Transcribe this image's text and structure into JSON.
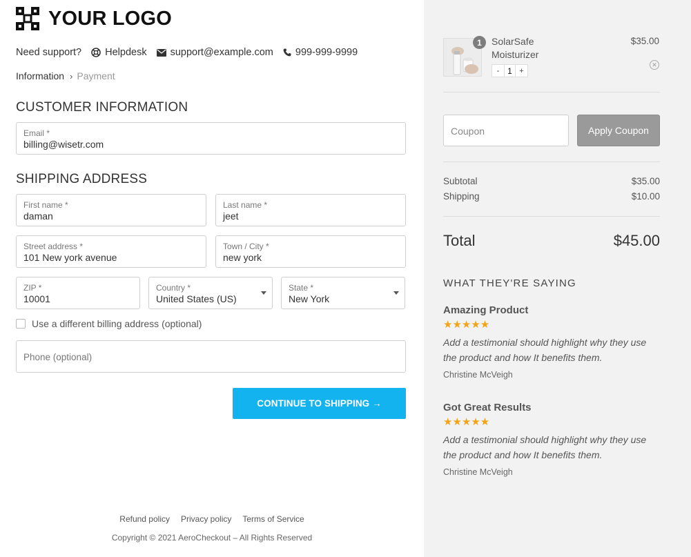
{
  "logo": {
    "text": "YOUR LOGO",
    "icon": "logo-mark-icon"
  },
  "support": {
    "label": "Need support?",
    "helpdesk": "Helpdesk",
    "email": "support@example.com",
    "phone": "999-999-9999"
  },
  "breadcrumb": {
    "step1": "Information",
    "step2": "Payment"
  },
  "customer_info": {
    "title": "CUSTOMER INFORMATION",
    "email_label": "Email *",
    "email_value": "billing@wisetr.com"
  },
  "shipping": {
    "title": "SHIPPING ADDRESS",
    "first_name_label": "First name *",
    "first_name_value": "daman",
    "last_name_label": "Last name *",
    "last_name_value": "jeet",
    "street_label": "Street address *",
    "street_value": "101 New york avenue",
    "city_label": "Town / City *",
    "city_value": "new york",
    "zip_label": "ZIP *",
    "zip_value": "10001",
    "country_label": "Country *",
    "country_value": "United States (US)",
    "state_label": "State *",
    "state_value": "New York",
    "billing_checkbox_label": "Use a different billing address (optional)",
    "phone_placeholder": "Phone (optional)"
  },
  "continue_button": "CONTINUE TO SHIPPING →",
  "footer": {
    "links": [
      "Refund policy",
      "Privacy policy",
      "Terms of Service"
    ],
    "copyright": "Copyright © 2021 AeroCheckout – All Rights Reserved"
  },
  "cart": {
    "item": {
      "name": "SolarSafe Moisturizer",
      "price": "$35.00",
      "quantity": "1",
      "badge": "1",
      "minus": "-",
      "plus": "+"
    },
    "coupon_placeholder": "Coupon",
    "apply_coupon": "Apply Coupon",
    "subtotal_label": "Subtotal",
    "subtotal_value": "$35.00",
    "shipping_label": "Shipping",
    "shipping_value": "$10.00",
    "total_label": "Total",
    "total_value": "$45.00"
  },
  "testimonials": {
    "title": "WHAT THEY'RE SAYING",
    "items": [
      {
        "title": "Amazing Product",
        "stars": "★★★★★",
        "rating": 5,
        "text": "Add a testimonial should highlight why they use the product and how It benefits them.",
        "author": "Christine McVeigh"
      },
      {
        "title": "Got Great Results",
        "stars": "★★★★★",
        "rating": 5,
        "text": "Add a testimonial should highlight why they use the product and how It benefits them.",
        "author": "Christine McVeigh"
      }
    ]
  },
  "colors": {
    "accent": "#12b3ee",
    "star": "#f1a417",
    "sidebar_bg": "#f2f2f2",
    "coupon_button": "#9a9a9a"
  }
}
